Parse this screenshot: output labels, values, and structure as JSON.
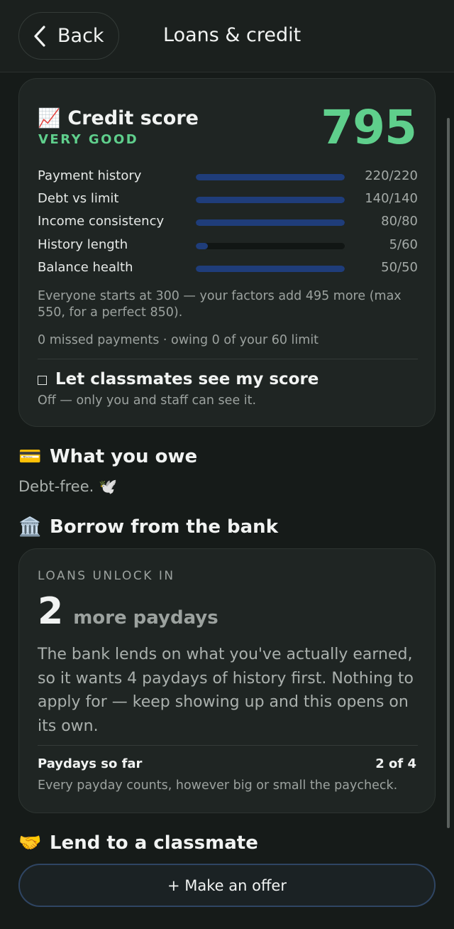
{
  "header": {
    "back_label": "Back",
    "title": "Loans & credit"
  },
  "credit": {
    "emoji": "📈",
    "title": "Credit score",
    "rating": "VERY GOOD",
    "score": "795",
    "factors": [
      {
        "name": "Payment history",
        "value": "220/220",
        "fraction": 1.0
      },
      {
        "name": "Debt vs limit",
        "value": "140/140",
        "fraction": 1.0
      },
      {
        "name": "Income consistency",
        "value": "80/80",
        "fraction": 1.0
      },
      {
        "name": "History length",
        "value": "5/60",
        "fraction": 0.0833
      },
      {
        "name": "Balance health",
        "value": "50/50",
        "fraction": 1.0
      }
    ],
    "explanation": "Everyone starts at 300 — your factors add 495 more (max 550, for a perfect 850).",
    "summary": "0 missed payments · owing 0 of your 60 limit",
    "share_label": "Let classmates see my score",
    "share_status": "Off — only you and staff can see it."
  },
  "owe": {
    "emoji": "💳",
    "title": "What you owe",
    "text": "Debt-free. 🕊️"
  },
  "borrow": {
    "emoji": "🏛️",
    "title": "Borrow from the bank",
    "unlock_label": "LOANS UNLOCK IN",
    "unlock_count": "2",
    "unlock_unit": "more paydays",
    "description": "The bank lends on what you've actually earned, so it wants 4 paydays of history first. Nothing to apply for — keep showing up and this opens on its own.",
    "progress_label": "Paydays so far",
    "progress_value": "2 of 4",
    "progress_note": "Every payday counts, however big or small the paycheck."
  },
  "lend": {
    "emoji": "🤝",
    "title": "Lend to a classmate",
    "button_label": "+ Make an offer"
  },
  "colors": {
    "accent_green": "#5fcf8c",
    "bar_blue": "#1f3d7a",
    "background": "#161b19"
  }
}
